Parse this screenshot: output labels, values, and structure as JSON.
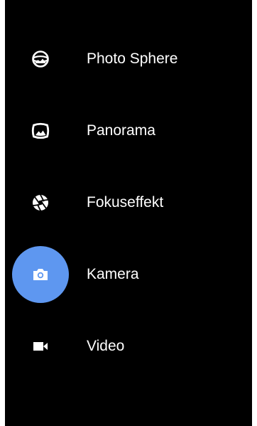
{
  "modes": [
    {
      "label": "Photo Sphere",
      "icon": "photo-sphere-icon",
      "selected": false
    },
    {
      "label": "Panorama",
      "icon": "panorama-icon",
      "selected": false
    },
    {
      "label": "Fokuseffekt",
      "icon": "aperture-icon",
      "selected": false
    },
    {
      "label": "Kamera",
      "icon": "camera-icon",
      "selected": true
    },
    {
      "label": "Video",
      "icon": "videocam-icon",
      "selected": false
    }
  ],
  "colors": {
    "background": "#000000",
    "text": "#ffffff",
    "selected_accent": "#5e97f0"
  }
}
